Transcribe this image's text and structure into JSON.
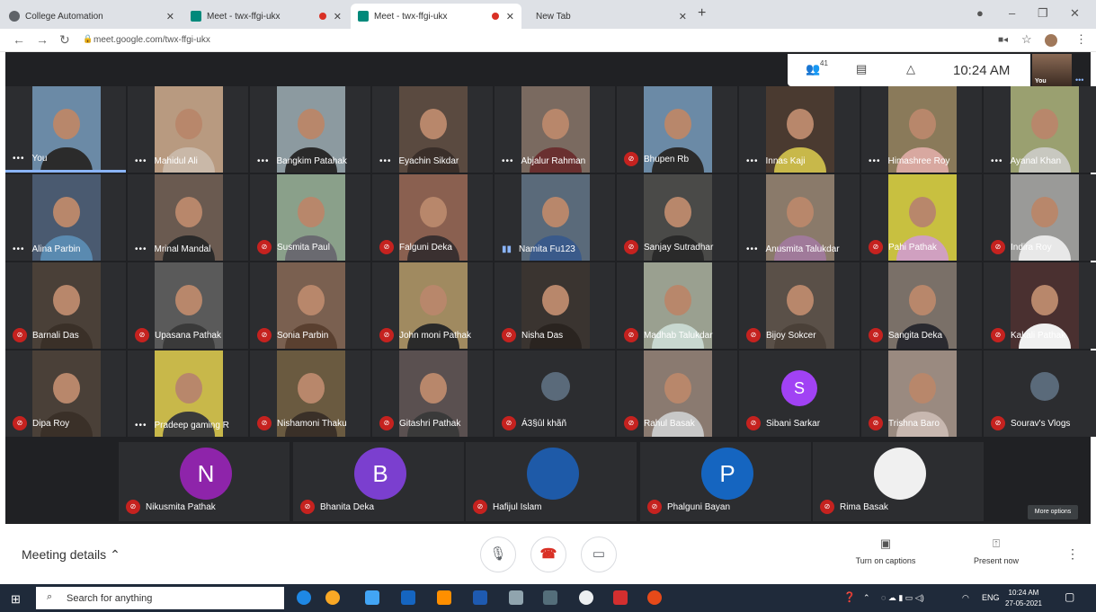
{
  "browser": {
    "tabs": [
      {
        "title": "College Automation",
        "favicon_color": "#5f6368",
        "recording": false
      },
      {
        "title": "Meet - twx-ffgi-ukx",
        "favicon_color": "#00897b",
        "recording": true
      },
      {
        "title": "Meet - twx-ffgi-ukx",
        "favicon_color": "#00897b",
        "recording": true
      },
      {
        "title": "New Tab",
        "favicon_color": "#dee1e6",
        "recording": false
      }
    ],
    "url": "meet.google.com/twx-ffgi-ukx"
  },
  "meet": {
    "participant_count": "41",
    "time": "10:24 AM",
    "self_label": "You",
    "grid": [
      [
        {
          "name": "You",
          "state": "dots",
          "bg": "#6b8aa6",
          "shirt": "#2b2b2b"
        },
        {
          "name": "Mahidul Ali",
          "state": "dots",
          "bg": "#b89a80",
          "shirt": "#c9b8a8"
        },
        {
          "name": "Bangkim Patahak",
          "state": "dots",
          "bg": "#8c9aa0",
          "shirt": "#2a2a2a"
        },
        {
          "name": "Eyachin Sikdar",
          "state": "dots",
          "bg": "#5a4a40",
          "shirt": "#3a2f2a"
        },
        {
          "name": "Abjalur Rahman",
          "state": "dots",
          "bg": "#7a6a60",
          "shirt": "#6a3030"
        },
        {
          "name": "Bhupen Rb",
          "state": "muted",
          "bg": "#6b8aa6",
          "shirt": "#2b2b2b"
        },
        {
          "name": "Innas Kaji",
          "state": "dots",
          "bg": "#4a3a30",
          "shirt": "#c8b84a"
        },
        {
          "name": "Himashree Roy",
          "state": "dots",
          "bg": "#8a7a5a",
          "shirt": "#d8a8a0"
        },
        {
          "name": "Ayanal Khan",
          "state": "dots",
          "bg": "#9aa070",
          "shirt": "#c8c8c0"
        }
      ],
      [
        {
          "name": "Alina Parbin",
          "state": "dots",
          "bg": "#4a5a70",
          "shirt": "#5a8ab0"
        },
        {
          "name": "Mrinal Mandal",
          "state": "dots",
          "bg": "#6a5a50",
          "shirt": "#2a2a2a"
        },
        {
          "name": "Susmita Paul",
          "state": "muted",
          "bg": "#8aa08a",
          "shirt": "#6a6a70"
        },
        {
          "name": "Falguni Deka",
          "state": "muted",
          "bg": "#8a6050",
          "shirt": "#3a3030"
        },
        {
          "name": "Namita Fu123",
          "state": "bars",
          "bg": "#5a6a7a",
          "shirt": "#3a5a8a"
        },
        {
          "name": "Sanjay Sutradhar",
          "state": "muted",
          "bg": "#4a4a48",
          "shirt": "#2a2a2a"
        },
        {
          "name": "Anusmita Talukdar",
          "state": "dots",
          "bg": "#8a7a6a",
          "shirt": "#a07a9a"
        },
        {
          "name": "Pahi Pathak",
          "state": "muted",
          "bg": "#c8c040",
          "shirt": "#d0a0c0"
        },
        {
          "name": "Indira Roy",
          "state": "muted",
          "bg": "#9a9a98",
          "shirt": "#e8e8e8"
        }
      ],
      [
        {
          "name": "Barnali Das",
          "state": "muted",
          "bg": "#4a4038",
          "shirt": "#3a3028"
        },
        {
          "name": "Upasana Pathak",
          "state": "muted",
          "bg": "#5a5a5a",
          "shirt": "#3a3a3a"
        },
        {
          "name": "Sonia Parbin",
          "state": "muted",
          "bg": "#7a6050",
          "shirt": "#5a4030"
        },
        {
          "name": "John moni Pathak",
          "state": "muted",
          "bg": "#a08a60",
          "shirt": "#2a2a2a"
        },
        {
          "name": "Nisha Das",
          "state": "muted",
          "bg": "#3a3430",
          "shirt": "#2a2420"
        },
        {
          "name": "Madhab Talukdar",
          "state": "muted",
          "bg": "#9aa090",
          "shirt": "#c8d8d0"
        },
        {
          "name": "Bijoy Sokcer",
          "state": "muted",
          "bg": "#5a5048",
          "shirt": "#4a4038"
        },
        {
          "name": "Sangita Deka",
          "state": "muted",
          "bg": "#7a7068",
          "shirt": "#2a2a30"
        },
        {
          "name": "Kakali Pathak",
          "state": "muted",
          "bg": "#4a3030",
          "shirt": "#f0f0f0"
        }
      ],
      [
        {
          "name": "Dipa Roy",
          "state": "muted",
          "bg": "#4a4038",
          "shirt": "#3a3028"
        },
        {
          "name": "Pradeep gaming R",
          "state": "dots",
          "bg": "#c8b84a",
          "shirt": "#3a3a3a"
        },
        {
          "name": "Nishamoni Thaku",
          "state": "muted",
          "bg": "#6a5a40",
          "shirt": "#3a3028"
        },
        {
          "name": "Gitashri Pathak",
          "state": "muted",
          "bg": "#5a5050",
          "shirt": "#3a3a3a"
        },
        {
          "name": "Á3§ûl khãñ",
          "state": "muted",
          "bg": "#2c2d30",
          "shirt": "#2c2d30",
          "avatar_photo": true
        },
        {
          "name": "Rahul Basak",
          "state": "muted",
          "bg": "#8a7a70",
          "shirt": "#c8c8c8"
        },
        {
          "name": "Sibani Sarkar",
          "state": "muted",
          "bg": "#2c2d30",
          "shirt": "#2c2d30",
          "letter": "S",
          "letter_color": "#a142f4"
        },
        {
          "name": "Trishna Baro",
          "state": "muted",
          "bg": "#9a8a80",
          "shirt": "#c8b8b0"
        },
        {
          "name": "Sourav's Vlogs",
          "state": "muted",
          "bg": "#2c2d30",
          "shirt": "#2c2d30",
          "avatar_photo": true
        }
      ]
    ],
    "bottom_row": [
      {
        "name": "Nikusmita Pathak",
        "letter": "N",
        "color": "#8e24aa"
      },
      {
        "name": "Bhanita Deka",
        "letter": "B",
        "color": "#7b3fcf"
      },
      {
        "name": "Hafijul Islam",
        "letter": "",
        "color": "#1e5aa8"
      },
      {
        "name": "Phalguni Bayan",
        "letter": "P",
        "color": "#1565c0"
      },
      {
        "name": "Rima Basak",
        "letter": "",
        "color": "#f0f0f0"
      }
    ],
    "more_options": "More options",
    "controls": {
      "meeting_details": "Meeting details",
      "captions": "Turn on captions",
      "present": "Present now"
    }
  },
  "taskbar": {
    "search_placeholder": "Search for anything",
    "lang": "ENG",
    "time": "10:24 AM",
    "date": "27-05-2021"
  }
}
